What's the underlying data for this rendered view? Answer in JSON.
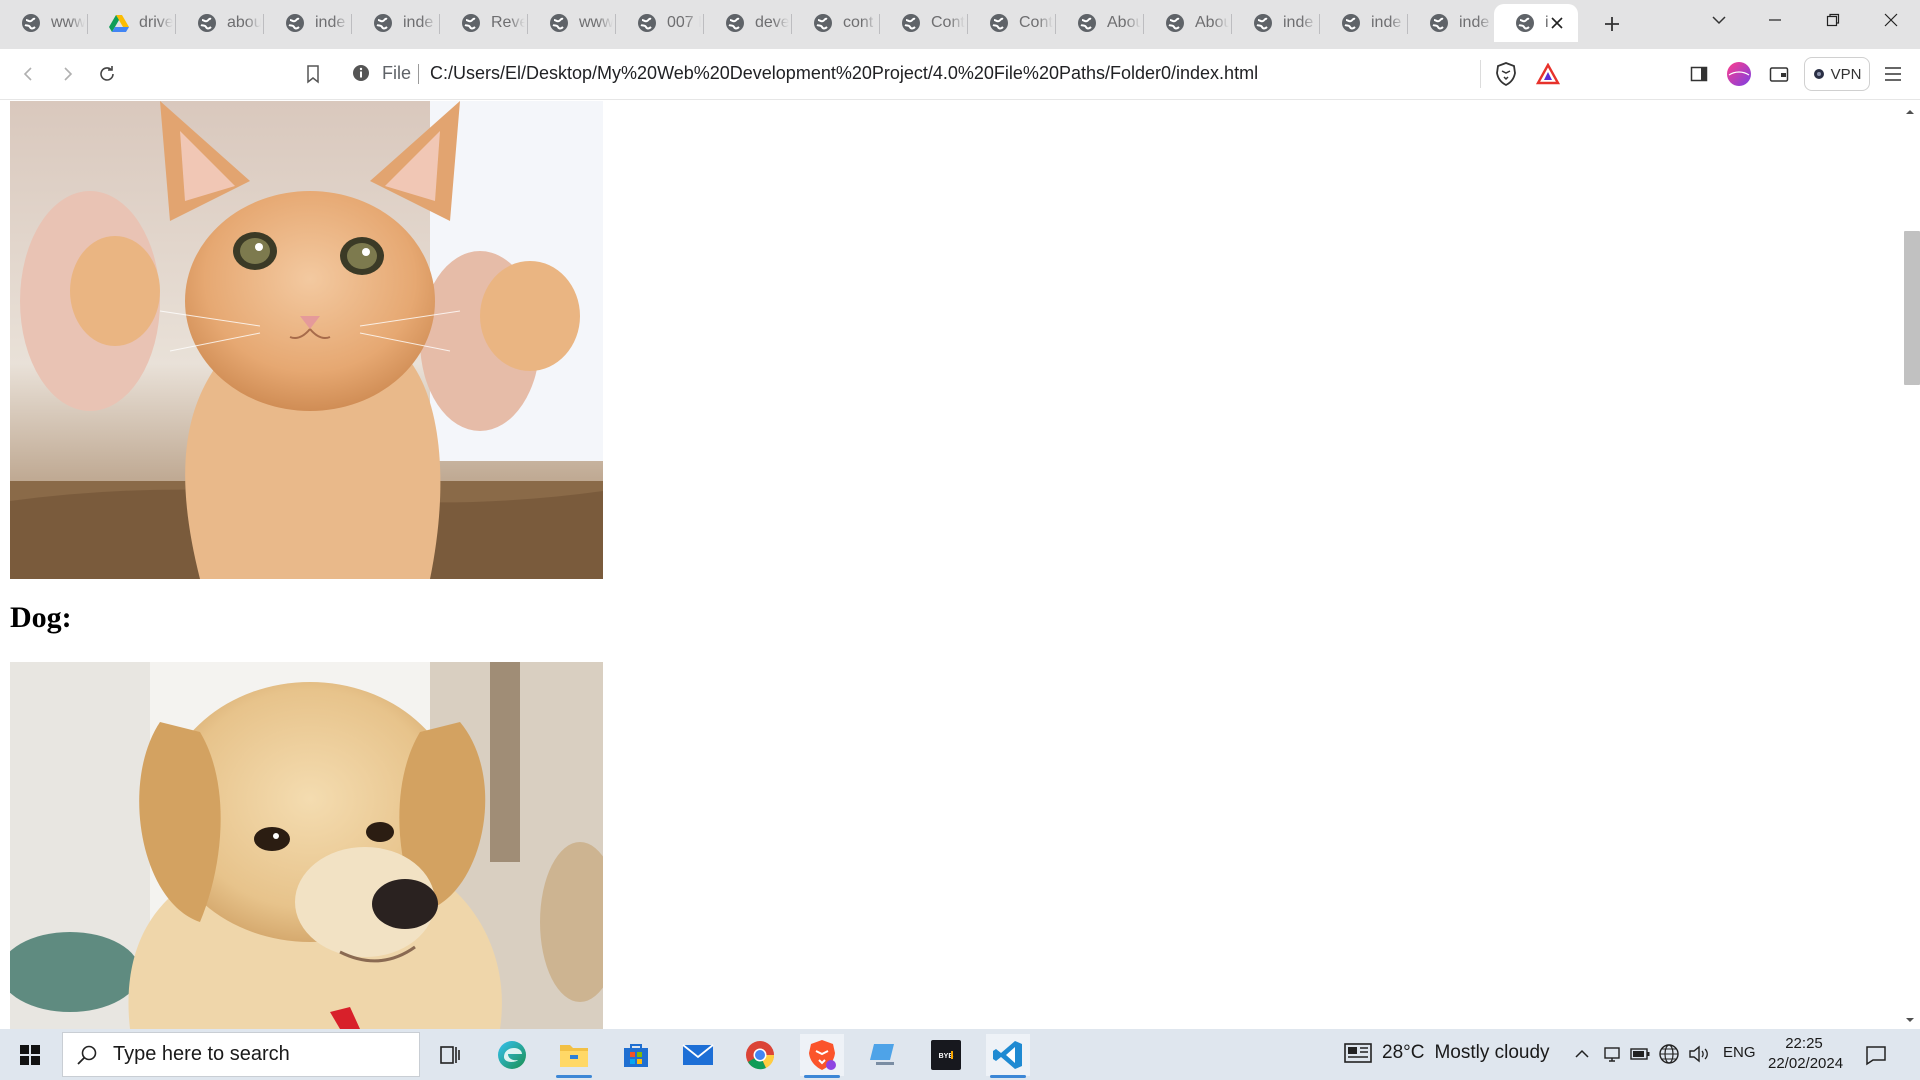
{
  "browser": {
    "tabs": [
      {
        "label": "www",
        "icon": "globe-icon"
      },
      {
        "label": "drive",
        "icon": "google-drive-icon"
      },
      {
        "label": "abou",
        "icon": "globe-icon"
      },
      {
        "label": "inde",
        "icon": "globe-icon"
      },
      {
        "label": "inde",
        "icon": "globe-icon"
      },
      {
        "label": "Reve",
        "icon": "globe-icon"
      },
      {
        "label": "www",
        "icon": "globe-icon"
      },
      {
        "label": "007 I",
        "icon": "globe-icon"
      },
      {
        "label": "deve",
        "icon": "globe-icon"
      },
      {
        "label": "cont",
        "icon": "globe-icon"
      },
      {
        "label": "Cont",
        "icon": "globe-icon"
      },
      {
        "label": "Cont",
        "icon": "globe-icon"
      },
      {
        "label": "Abou",
        "icon": "globe-icon"
      },
      {
        "label": "Abou",
        "icon": "globe-icon"
      },
      {
        "label": "inde",
        "icon": "globe-icon"
      },
      {
        "label": "inde",
        "icon": "globe-icon"
      },
      {
        "label": "inde",
        "icon": "globe-icon"
      },
      {
        "label": "i",
        "icon": "globe-icon",
        "active": true
      }
    ],
    "address": {
      "scheme_label": "File",
      "url": "C:/Users/El/Desktop/My%20Web%20Development%20Project/4.0%20File%20Paths/Folder0/index.html"
    },
    "vpn_label": "VPN"
  },
  "page": {
    "dog_heading": "Dog:"
  },
  "taskbar": {
    "search_placeholder": "Type here to search",
    "weather": {
      "temp": "28°C",
      "condition": "Mostly cloudy"
    },
    "language": "ENG",
    "time": "22:25",
    "date": "22/02/2024",
    "apps": [
      "task-view",
      "edge",
      "file-explorer",
      "microsoft-store",
      "mail",
      "chrome",
      "brave",
      "remote-desktop",
      "bybit",
      "vscode"
    ]
  },
  "colors": {
    "tabstrip_bg": "#e3e3e4",
    "taskbar_bg": "#dfe6ee",
    "accent_blue": "#3c87d6",
    "brave_orange": "#fb542b"
  }
}
